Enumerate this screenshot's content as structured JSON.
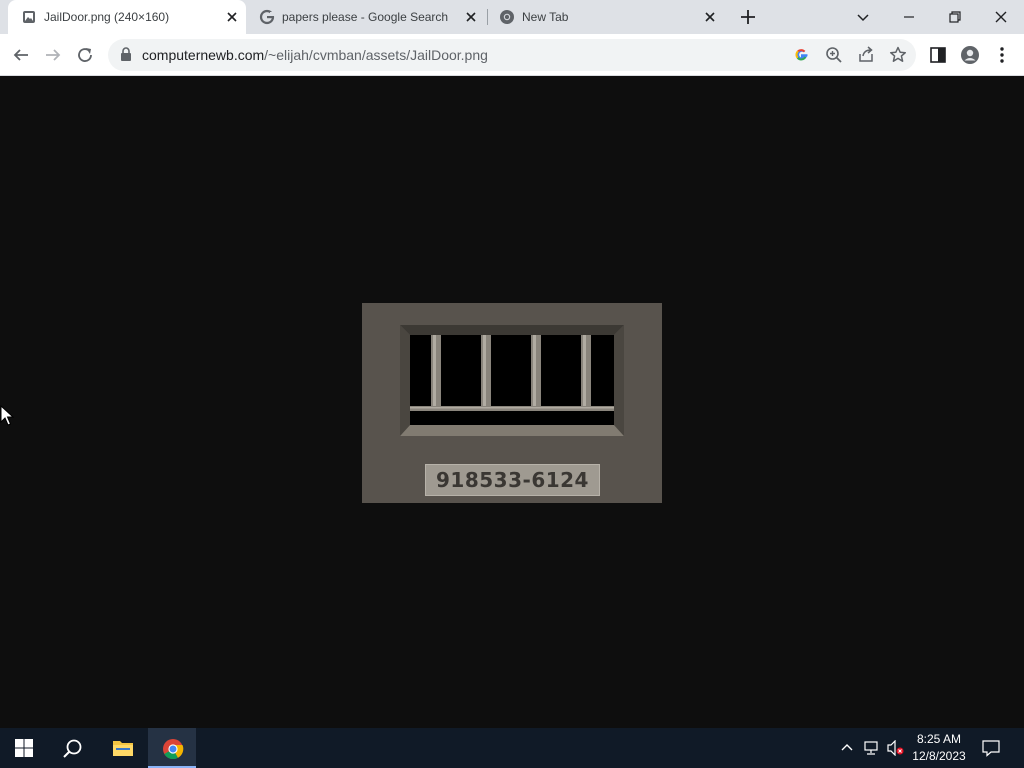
{
  "browser": {
    "tabs": [
      {
        "title": "JailDoor.png (240×160)",
        "favicon": "image-file-icon",
        "active": true
      },
      {
        "title": "papers please - Google Search",
        "favicon": "google-g-icon",
        "active": false
      },
      {
        "title": "New Tab",
        "favicon": "chrome-icon",
        "active": false
      }
    ],
    "address": {
      "domain": "computernewb.com",
      "path": "/~elijah/cvmban/assets/JailDoor.png"
    }
  },
  "image": {
    "plate_text": "918533-6124",
    "colors": {
      "frame": "#58534d",
      "plate": "#9f9a91",
      "bars": "#8a857c",
      "window": "#000000"
    }
  },
  "taskbar": {
    "time": "8:25 AM",
    "date": "12/8/2023",
    "accent": "#8ab4f8"
  }
}
